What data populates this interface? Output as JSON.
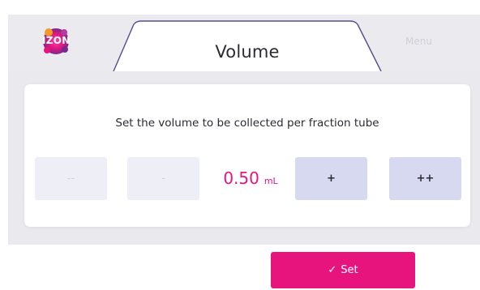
{
  "header": {
    "logo_text": "IZON",
    "tab_title": "Volume",
    "menu_label": "Menu"
  },
  "volume_panel": {
    "prompt": "Set the volume to be collected per fraction tube",
    "decrease_large_label": "--",
    "decrease_label": "-",
    "increase_label": "+",
    "increase_large_label": "++",
    "value": "0.50",
    "unit": "mL"
  },
  "footer": {
    "set_label": "Set",
    "check_icon": "check-icon"
  },
  "colors": {
    "accent": "#e8147e",
    "header_bg": "#ebebef",
    "active_button": "#d6d9ef",
    "disabled_button": "#eeeff6"
  }
}
